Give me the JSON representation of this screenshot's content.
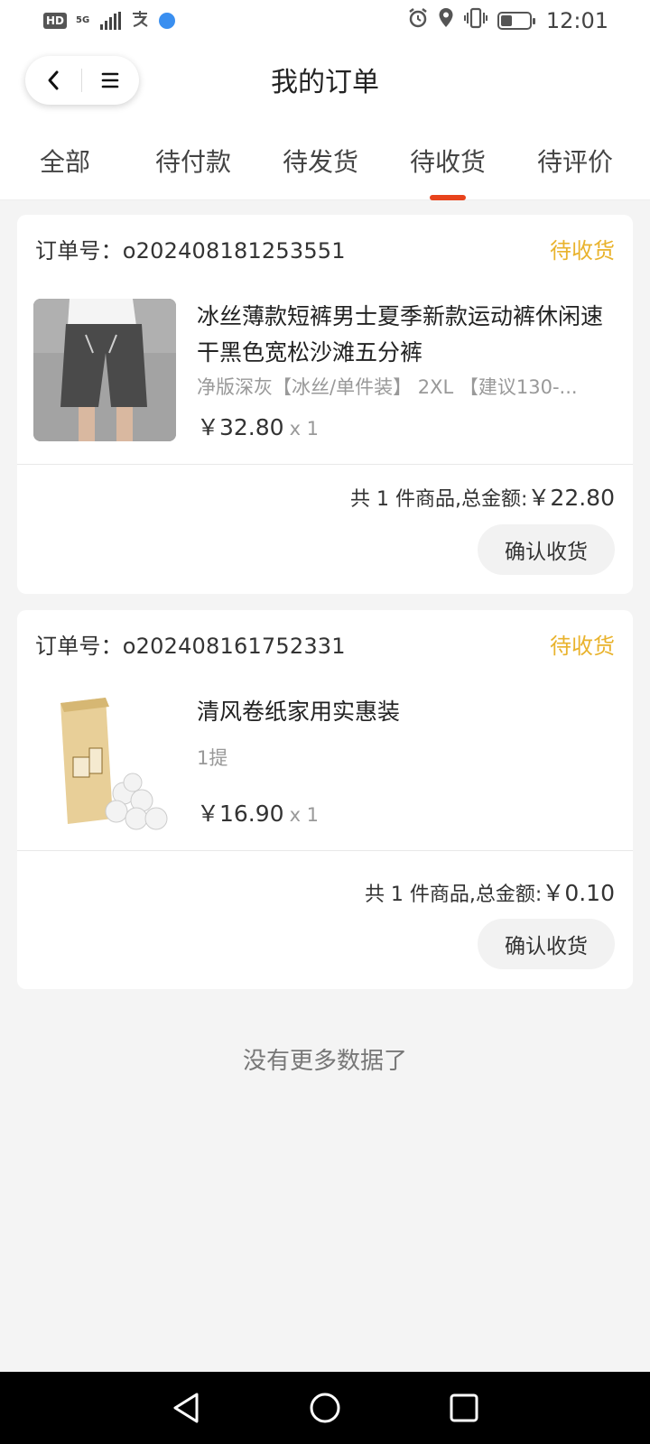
{
  "status_bar": {
    "hd": "HD",
    "network": "5G",
    "time": "12:01",
    "icons": [
      "signal-icon",
      "alipay-icon",
      "globe-icon",
      "alarm-icon",
      "location-icon",
      "vibrate-icon",
      "battery-icon"
    ]
  },
  "header": {
    "title": "我的订单",
    "capsule_icons": [
      "back-icon",
      "menu-icon"
    ]
  },
  "tabs": [
    {
      "label": "全部",
      "active": false
    },
    {
      "label": "待付款",
      "active": false
    },
    {
      "label": "待发货",
      "active": false
    },
    {
      "label": "待收货",
      "active": true
    },
    {
      "label": "待评价",
      "active": false
    }
  ],
  "orders": [
    {
      "order_no": "订单号：o202408181253551",
      "status": "待收货",
      "product": {
        "title": "冰丝薄款短裤男士夏季新款运动裤休闲速干黑色宽松沙滩五分裤",
        "spec": "净版深灰【冰丝/单件装】 2XL 【建议130-...",
        "price": "￥32.80",
        "qty": "x 1",
        "image": "grey-shorts-photo"
      },
      "summary_label": "共 1 件商品,总金额:",
      "summary_amount": "￥22.80",
      "button": "确认收货"
    },
    {
      "order_no": "订单号：o202408161752331",
      "status": "待收货",
      "product": {
        "title": "清风卷纸家用实惠装",
        "spec": "1提",
        "price": "￥16.90",
        "qty": "x 1",
        "image": "toilet-paper-photo"
      },
      "summary_label": "共 1 件商品,总金额:",
      "summary_amount": "￥0.10",
      "button": "确认收货"
    }
  ],
  "footer_text": "没有更多数据了",
  "colors": {
    "accent": "#e8431c",
    "status": "#e9b32d",
    "background": "#f4f4f4"
  },
  "nav_icons": [
    "nav-back-icon",
    "nav-home-icon",
    "nav-recents-icon"
  ]
}
